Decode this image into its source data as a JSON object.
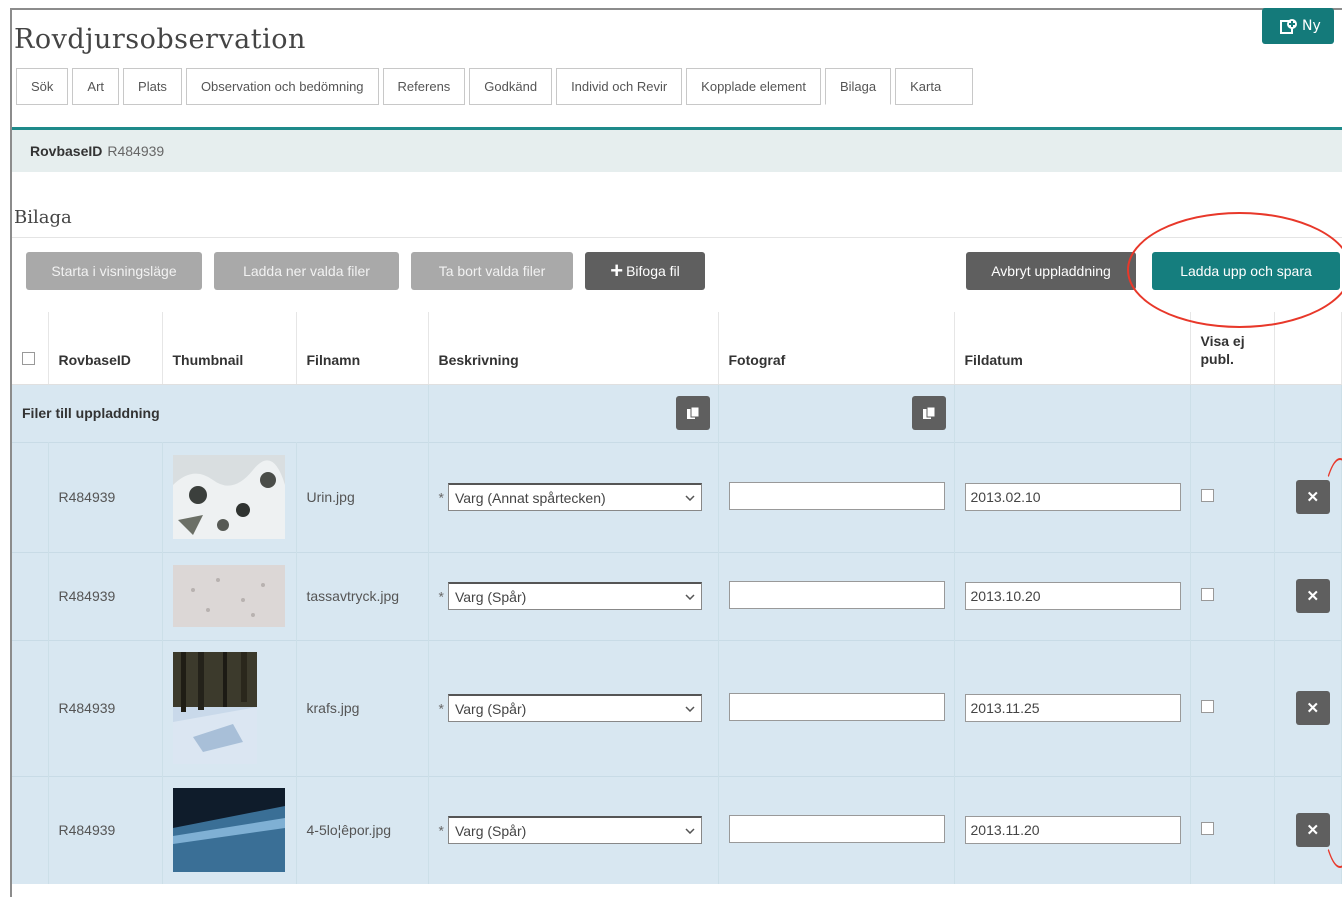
{
  "app": {
    "title": "Rovdjursobservation",
    "new_button": "Ny"
  },
  "tabs": [
    {
      "label": "Sök",
      "active": false
    },
    {
      "label": "Art",
      "active": false
    },
    {
      "label": "Plats",
      "active": false
    },
    {
      "label": "Observation och bedömning",
      "active": false
    },
    {
      "label": "Referens",
      "active": false
    },
    {
      "label": "Godkänd",
      "active": false
    },
    {
      "label": "Individ och Revir",
      "active": false
    },
    {
      "label": "Kopplade element",
      "active": false
    },
    {
      "label": "Bilaga",
      "active": true
    },
    {
      "label": "Karta",
      "active": false
    }
  ],
  "record": {
    "id_label": "RovbaseID",
    "id_value": "R484939"
  },
  "section": {
    "title": "Bilaga"
  },
  "toolbar": {
    "start_view": "Starta i visningsläge",
    "download_selected": "Ladda ner valda filer",
    "delete_selected": "Ta bort valda filer",
    "attach_file": "Bifoga fil",
    "cancel_upload": "Avbryt uppladdning",
    "upload_save": "Ladda upp och spara"
  },
  "table": {
    "headers": {
      "rovbase_id": "RovbaseID",
      "thumbnail": "Thumbnail",
      "filename": "Filnamn",
      "description": "Beskrivning",
      "photographer": "Fotograf",
      "file_date": "Fildatum",
      "hide_publish": "Visa ej publ."
    },
    "group_label": "Filer till uppladdning",
    "rows": [
      {
        "id": "R484939",
        "filename": "Urin.jpg",
        "description": "Varg (Annat spårtecken)",
        "photographer": "",
        "date": "2013.02.10"
      },
      {
        "id": "R484939",
        "filename": "tassavtryck.jpg",
        "description": "Varg (Spår)",
        "photographer": "",
        "date": "2013.10.20"
      },
      {
        "id": "R484939",
        "filename": "krafs.jpg",
        "description": "Varg (Spår)",
        "photographer": "",
        "date": "2013.11.25"
      },
      {
        "id": "R484939",
        "filename": "4-5lo¦êpor.jpg",
        "description": "Varg (Spår)",
        "photographer": "",
        "date": "2013.11.20"
      }
    ]
  },
  "colors": {
    "accent": "#157e7e",
    "annotation": "#e8382a",
    "row_bg": "#d8e7f1"
  }
}
